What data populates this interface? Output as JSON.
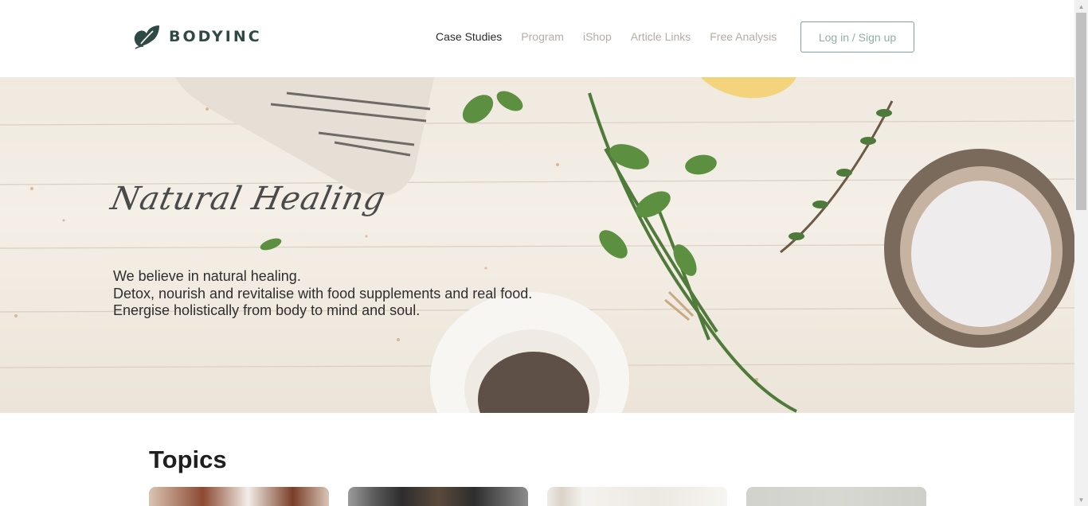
{
  "brand": {
    "name": "BODYINC",
    "logo_icon": "leaf-logo-icon"
  },
  "nav": {
    "items": [
      {
        "label": "Case Studies",
        "active": true
      },
      {
        "label": "Program",
        "active": false
      },
      {
        "label": "iShop",
        "active": false
      },
      {
        "label": "Article Links",
        "active": false
      },
      {
        "label": "Free Analysis",
        "active": false
      }
    ],
    "login_label": "Log in / Sign up"
  },
  "hero": {
    "script_title": "Natural Healing",
    "lines": [
      "We believe in natural healing.",
      "Detox, nourish and revitalise with food supplements and real food.",
      "Energise holistically from body to mind and soul."
    ]
  },
  "topics": {
    "title": "Topics"
  },
  "colors": {
    "accent": "#7ea396",
    "nav_inactive": "#b9aca2",
    "brand": "#2f4a45"
  }
}
